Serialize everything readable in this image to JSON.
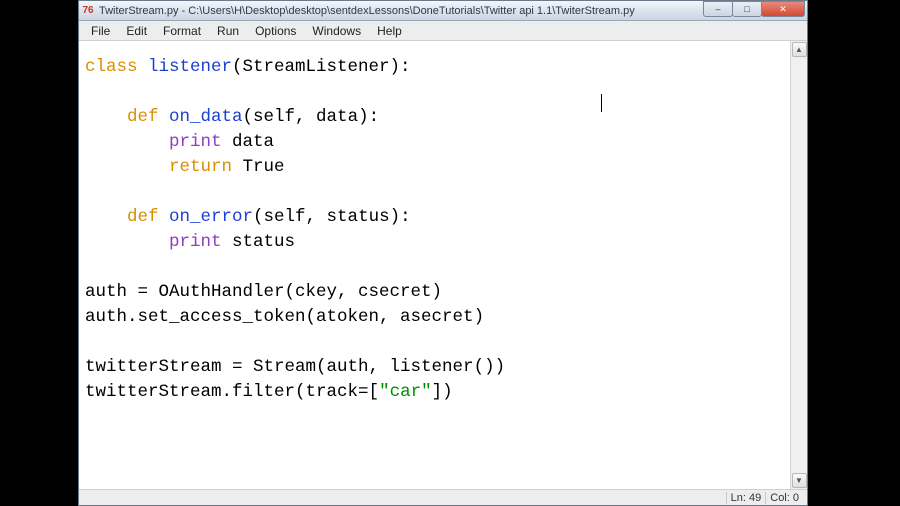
{
  "titlebar": {
    "icon_text": "76",
    "text": "TwiterStream.py - C:\\Users\\H\\Desktop\\desktop\\sentdexLessons\\DoneTutorials\\Twitter api 1.1\\TwiterStream.py"
  },
  "window_controls": {
    "minimize": "–",
    "maximize": "□",
    "close": "✕"
  },
  "menubar": {
    "file": "File",
    "edit": "Edit",
    "format": "Format",
    "run": "Run",
    "options": "Options",
    "windows": "Windows",
    "help": "Help"
  },
  "code": {
    "kw_class": "class",
    "cls_name": " listener",
    "cls_arg": "(StreamListener):",
    "kw_def1": "def",
    "fn_on_data": " on_data",
    "on_data_args": "(self, data):",
    "kw_print1": "print",
    "print1_rest": " data",
    "kw_return": "return",
    "ret_rest": " True",
    "kw_def2": "def",
    "fn_on_error": " on_error",
    "on_error_args": "(self, status):",
    "kw_print2": "print",
    "print2_rest": " status",
    "auth_line1": "auth = OAuthHandler(ckey, csecret)",
    "auth_line2": "auth.set_access_token(atoken, asecret)",
    "ts_line1": "twitterStream = Stream(auth, listener())",
    "ts_line2a": "twitterStream.filter(track=[",
    "ts_str": "\"car\"",
    "ts_line2b": "])"
  },
  "status": {
    "line": "Ln: 49",
    "col": "Col: 0"
  }
}
